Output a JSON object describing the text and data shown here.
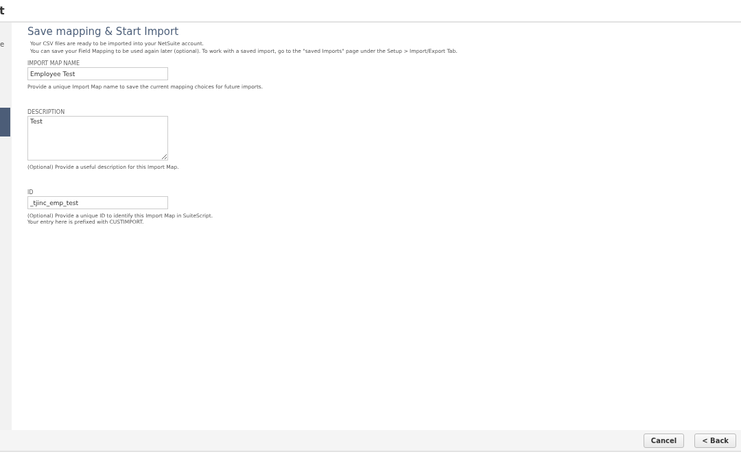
{
  "header": {
    "title": "t"
  },
  "sidebar": {
    "text": "e"
  },
  "form": {
    "title": "Save mapping & Start Import",
    "intro": [
      "Your CSV files are ready to be imported into your NetSuite account.",
      "You can save your Field Mapping to be used again later (optional). To work with a saved import, go to the \"saved Imports\" page under the Setup > Import/Export Tab."
    ],
    "fields": [
      {
        "kind": "input",
        "label": "IMPORT MAP NAME",
        "value": "Employee Test",
        "help": [
          "Provide a unique Import Map name to save the current mapping choices for future imports."
        ]
      },
      {
        "kind": "textarea",
        "label": "DESCRIPTION",
        "value": "Test",
        "help": [
          "(Optional) Provide a useful description for this Import Map."
        ]
      },
      {
        "kind": "input",
        "label": "ID",
        "value": "_tjinc_emp_test",
        "help": [
          "(Optional) Provide a unique ID to identify this Import Map in SuiteScript.",
          "Your entry here is prefixed with CUSTIMPORT."
        ]
      }
    ]
  },
  "buttons": [
    "Cancel",
    "< Back"
  ]
}
